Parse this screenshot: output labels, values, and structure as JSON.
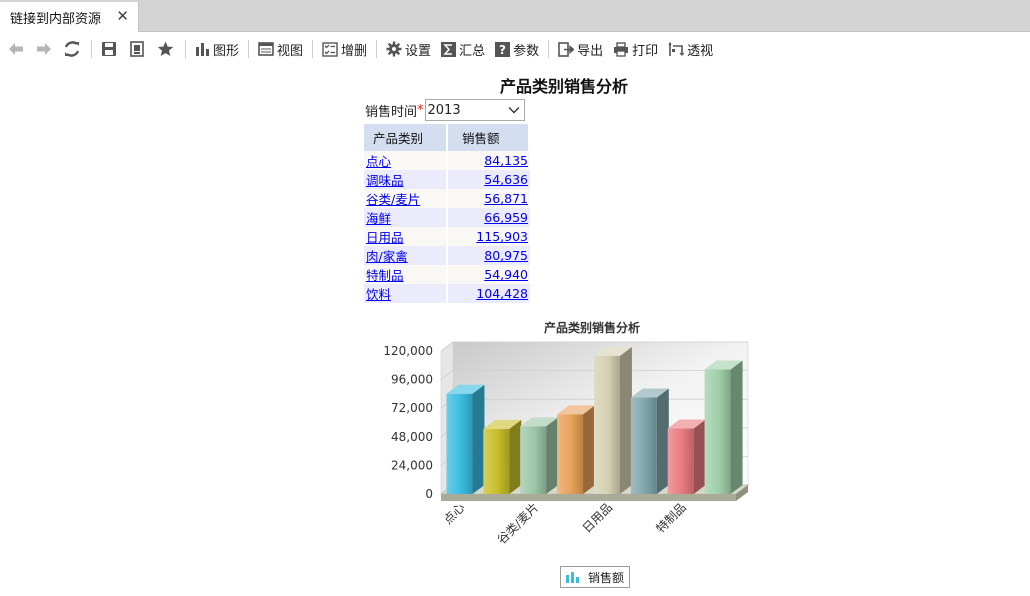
{
  "tab": {
    "title": "链接到内部资源",
    "close_glyph": "✕"
  },
  "toolbar": {
    "chart_label": "图形",
    "view_label": "视图",
    "crud_label": "增删",
    "settings_label": "设置",
    "summary_label": "汇总",
    "params_label": "参数",
    "export_label": "导出",
    "print_label": "打印",
    "pivot_label": "透视"
  },
  "report": {
    "title": "产品类别销售分析",
    "filter_label": "销售时间",
    "filter_required_mark": "*",
    "filter_value": "2013",
    "table": {
      "headers": [
        "产品类别",
        "销售额"
      ],
      "rows": [
        {
          "category": "点心",
          "amount": "84,135"
        },
        {
          "category": "调味品",
          "amount": "54,636"
        },
        {
          "category": "谷类/麦片",
          "amount": "56,871"
        },
        {
          "category": "海鲜",
          "amount": "66,959"
        },
        {
          "category": "日用品",
          "amount": "115,903"
        },
        {
          "category": "肉/家禽",
          "amount": "80,975"
        },
        {
          "category": "特制品",
          "amount": "54,940"
        },
        {
          "category": "饮料",
          "amount": "104,428"
        }
      ]
    }
  },
  "chart_data": {
    "type": "bar",
    "title": "产品类别销售分析",
    "categories": [
      "点心",
      "调味品",
      "谷类/麦片",
      "海鲜",
      "日用品",
      "肉/家禽",
      "特制品",
      "饮料"
    ],
    "x_tick_labels": [
      "点心",
      "谷类/麦片",
      "日用品",
      "特制品"
    ],
    "series": [
      {
        "name": "销售额",
        "values": [
          84135,
          54636,
          56871,
          66959,
          115903,
          80975,
          54940,
          104428
        ]
      }
    ],
    "ylim": [
      0,
      120000
    ],
    "y_ticks": [
      "0",
      "24,000",
      "48,000",
      "72,000",
      "96,000",
      "120,000"
    ],
    "bar_colors": [
      "#3bbde0",
      "#c9be2a",
      "#9cc6a6",
      "#e9a05a",
      "#d4d0b2",
      "#7fa6ac",
      "#e97b80",
      "#9fcfa9"
    ],
    "style": "3d",
    "legend_position": "bottom"
  }
}
